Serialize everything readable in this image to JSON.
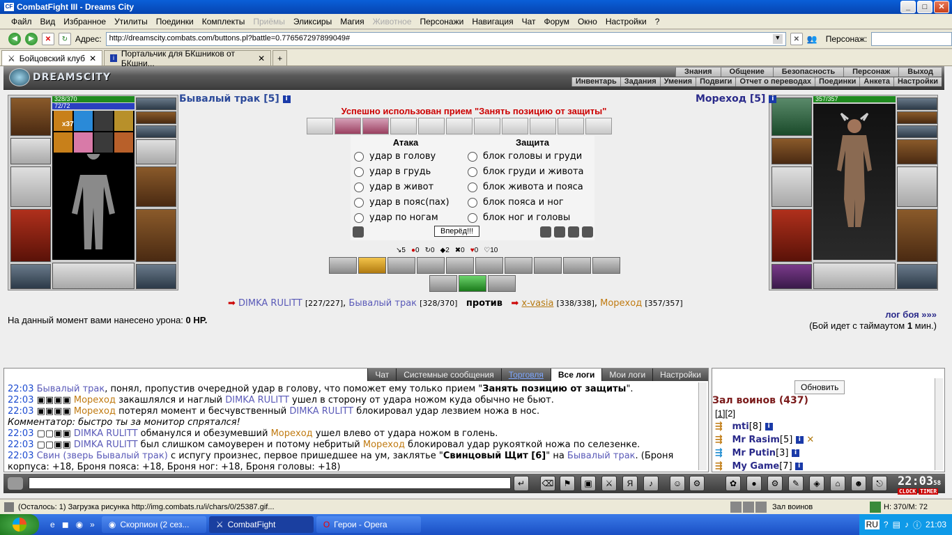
{
  "window": {
    "title": "CombatFight III - Dreams City",
    "icon": "combatfight-icon"
  },
  "menu": [
    "Файл",
    "Вид",
    "Избранное",
    "Утилиты",
    "Поединки",
    "Комплекты",
    "Приёмы",
    "Эликсиры",
    "Магия",
    "Животное",
    "Персонажи",
    "Навигация",
    "Чат",
    "Форум",
    "Окно",
    "Настройки",
    "?"
  ],
  "address": {
    "label": "Адрес:",
    "url": "http://dreamscity.combats.com/buttons.pl?battle=0.776567297899049#",
    "persona_label": "Персонаж:"
  },
  "tabs": [
    {
      "label": "Бойцовский клуб",
      "active": true
    },
    {
      "label": "Портальчик для БКшников от БКшни...",
      "active": false
    }
  ],
  "game": {
    "logo": "DREAMSCITY",
    "topnav": [
      "Знания",
      "Общение",
      "Безопасность",
      "Персонаж",
      "Выход"
    ],
    "subnav": [
      "Инвентарь",
      "Задания",
      "Умения",
      "Подвиги",
      "Отчет о переводах",
      "Поединки",
      "Анкета",
      "Настройки"
    ]
  },
  "left": {
    "name": "Бывалый трак [5]",
    "hp": "328/370",
    "mp": "72/72",
    "buff": "x37"
  },
  "right": {
    "name": "Мореход [5]",
    "hp": "357/357"
  },
  "center": {
    "message": "Успешно использован прием \"Занять позицию от защиты\"",
    "attack_title": "Атака",
    "defense_title": "Защита",
    "attack": [
      "удар в голову",
      "удар в грудь",
      "удар в живот",
      "удар в пояс(пах)",
      "удар по ногам"
    ],
    "defense": [
      "блок головы и груди",
      "блок груди и живота",
      "блок живота и пояса",
      "блок пояса и ног",
      "блок ног и головы"
    ],
    "go_button": "Вперёд!!!",
    "stats": [
      "5",
      "0",
      "0",
      "2",
      "0",
      "0",
      "10"
    ]
  },
  "teams": {
    "p1": "DIMKA RULITT",
    "p1_hp": "[227/227]",
    "p2": "Бывалый трак",
    "p2_hp": "[328/370]",
    "vs": "против",
    "e1": "x-vasia",
    "e1_hp": "[338/338]",
    "e2": "Мореход",
    "e2_hp": "[357/357]"
  },
  "damage_text": "На данный момент вами нанесено урона:",
  "damage_value": "0 HP.",
  "log_link": "лог боя »»»",
  "timeout_text": "(Бой идет с таймаутом",
  "timeout_value": "1",
  "timeout_unit": "мин.)",
  "chat_tabs": [
    "Чат",
    "Системные сообщения",
    "Торговля",
    "Все логи",
    "Мои логи",
    "Настройки"
  ],
  "chat": [
    {
      "time": "22:03",
      "a": "Бывалый трак",
      "text": ", понял, пропустив очередной удар в голову, что поможет ему только прием \"",
      "bold": "Занять позицию от защиты",
      "end": "\"."
    },
    {
      "time": "22:03",
      "a": "Мореход",
      "text": " закашлялся и наглый ",
      "b": "DIMKA RULITT",
      "end": " ушел в сторону от удара ножом куда обычно не бьют."
    },
    {
      "time": "22:03",
      "a": "Мореход",
      "text": " потерял момент и бесчувственный ",
      "b": "DIMKA RULITT",
      "end": " блокировал удар лезвием ножа в нос."
    },
    {
      "comment": "Комментатор: быстро ты за монитор спрятался!"
    },
    {
      "time": "22:03",
      "a": "DIMKA RULITT",
      "text": " обманулся и обезумевший ",
      "b": "Мореход",
      "end": " ушел влево от удара ножом в голень."
    },
    {
      "time": "22:03",
      "a": "DIMKA RULITT",
      "text": " был слишком самоуверен и потому небритый ",
      "b": "Мореход",
      "end": " блокировал удар рукояткой ножа по селезенке."
    },
    {
      "time": "22:03",
      "a": "Свин (зверь Бывалый трак)",
      "text": " с испугу произнес, первое пришедшее на ум, заклятье \"",
      "bold": "Свинцовый Щит [6]",
      "mid": "\" на ",
      "b": "Бывалый трак",
      "end": ". (Броня корпуса: +18, Броня пояса: +18, Броня ног: +18, Броня головы: +18)"
    }
  ],
  "side": {
    "refresh": "Обновить",
    "hall_title": "Зал воинов (437)",
    "pages": [
      "1",
      "2"
    ],
    "players": [
      {
        "name": "mti",
        "lvl": "[8]"
      },
      {
        "name": "Mr Rasim",
        "lvl": "[5]"
      },
      {
        "name": "Mr Putin",
        "lvl": "[3]"
      },
      {
        "name": "My Game",
        "lvl": "[7]"
      }
    ]
  },
  "clock": {
    "time": "22:03",
    "sec": "58",
    "tag1": "CLOCK",
    "tag2": "TIMER"
  },
  "status": {
    "left": "(Осталось: 1) Загрузка рисунка http://img.combats.ru/i/chars/0/25387.gif...",
    "hall": "Зал воинов",
    "hm": "Н: 370/М: 72"
  },
  "taskbar": {
    "tasks": [
      "Скорпион (2 сез...",
      "CombatFight",
      "Герои - Opera"
    ],
    "lang": "RU",
    "time": "21:03"
  }
}
